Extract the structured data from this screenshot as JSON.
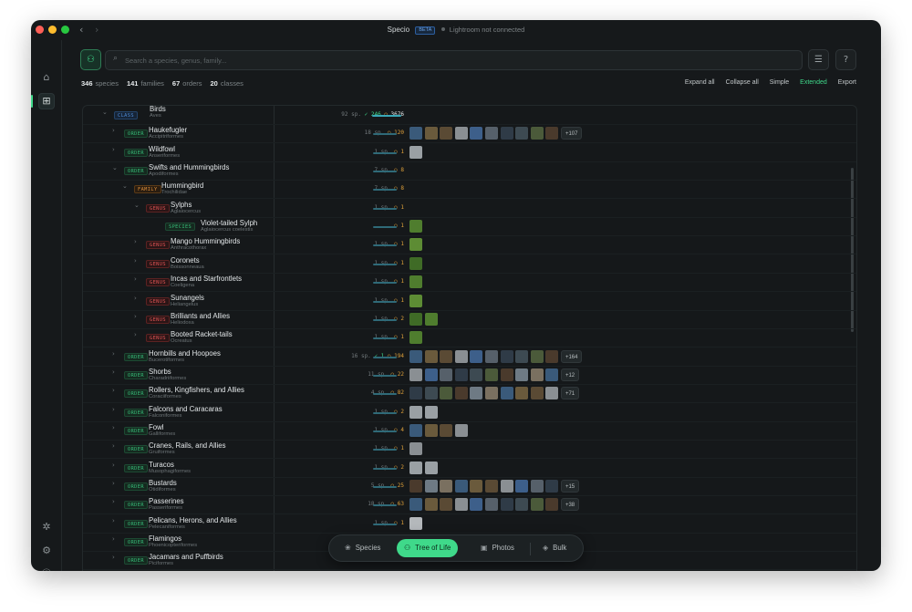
{
  "app": {
    "title": "Specio",
    "badge": "BETA",
    "connection": "Lightroom not connected"
  },
  "rail": {
    "home_icon": "home-icon",
    "grid_icon": "grid-icon",
    "bug_icon": "bug-icon",
    "settings_icon": "gear-icon",
    "help_icon": "help-icon"
  },
  "search": {
    "placeholder": "Search a species, genus, family...",
    "value": ""
  },
  "stats": [
    {
      "count": "346",
      "label": "species"
    },
    {
      "count": "141",
      "label": "families"
    },
    {
      "count": "67",
      "label": "orders"
    },
    {
      "count": "20",
      "label": "classes"
    }
  ],
  "actions": [
    "Expand all",
    "Collapse all",
    "Simple",
    "Extended",
    "Export"
  ],
  "active_action": "Extended",
  "colors": {
    "accent": "#3fd98a",
    "order": "#37bf7a",
    "family": "#d98c3a",
    "genus": "#e05454",
    "class": "#4d8ad6"
  },
  "rows": [
    {
      "rank": "CLASS",
      "name": "Birds",
      "sci": "Aves",
      "depth": 0,
      "chev": "⌄",
      "species": "92 sp.",
      "seen": "246",
      "photos": "3676",
      "bar": 1.0,
      "thumbs": 0,
      "more": ""
    },
    {
      "rank": "ORDER",
      "name": "Haukefugler",
      "sci": "Accipitriformes",
      "depth": 1,
      "chev": "›",
      "species": "18 sp.",
      "seen": "",
      "photos": "120",
      "bar": 0.8,
      "thumbs": 10,
      "more": "+107"
    },
    {
      "rank": "ORDER",
      "name": "Wildfowl",
      "sci": "Anseriformes",
      "depth": 1,
      "chev": "›",
      "species": "1 sp.",
      "seen": "",
      "photos": "1",
      "bar": 0.8,
      "thumbs": 1,
      "more": ""
    },
    {
      "rank": "ORDER",
      "name": "Swifts and Hummingbirds",
      "sci": "Apodiformes",
      "depth": 1,
      "chev": "⌄",
      "species": "7 sp.",
      "seen": "",
      "photos": "8",
      "bar": 0.8,
      "thumbs": 0,
      "more": ""
    },
    {
      "rank": "FAMILY",
      "name": "Hummingbird",
      "sci": "Trochilidae",
      "depth": 2,
      "chev": "⌄",
      "species": "7 sp.",
      "seen": "",
      "photos": "8",
      "bar": 0.8,
      "thumbs": 0,
      "more": ""
    },
    {
      "rank": "GENUS",
      "name": "Sylphs",
      "sci": "Aglaiocercus",
      "depth": 3,
      "chev": "⌄",
      "species": "1 sp.",
      "seen": "",
      "photos": "1",
      "bar": 0.8,
      "thumbs": 0,
      "more": ""
    },
    {
      "rank": "SPECIES",
      "name": "Violet-tailed Sylph",
      "sci": "Aglaiocercus coelestis",
      "depth": 4,
      "chev": "",
      "species": "",
      "seen": "",
      "photos": "1",
      "bar": 0.8,
      "thumbs": 1,
      "more": ""
    },
    {
      "rank": "GENUS",
      "name": "Mango Hummingbirds",
      "sci": "Anthracothorax",
      "depth": 3,
      "chev": "›",
      "species": "1 sp.",
      "seen": "",
      "photos": "1",
      "bar": 0.8,
      "thumbs": 1,
      "more": ""
    },
    {
      "rank": "GENUS",
      "name": "Coronets",
      "sci": "Boissonneaua",
      "depth": 3,
      "chev": "›",
      "species": "1 sp.",
      "seen": "",
      "photos": "1",
      "bar": 0.8,
      "thumbs": 1,
      "more": ""
    },
    {
      "rank": "GENUS",
      "name": "Incas and Starfrontlets",
      "sci": "Coeligena",
      "depth": 3,
      "chev": "›",
      "species": "1 sp.",
      "seen": "",
      "photos": "1",
      "bar": 0.8,
      "thumbs": 1,
      "more": ""
    },
    {
      "rank": "GENUS",
      "name": "Sunangels",
      "sci": "Heliangelus",
      "depth": 3,
      "chev": "›",
      "species": "1 sp.",
      "seen": "",
      "photos": "1",
      "bar": 0.8,
      "thumbs": 1,
      "more": ""
    },
    {
      "rank": "GENUS",
      "name": "Brilliants and Allies",
      "sci": "Heliodoxa",
      "depth": 3,
      "chev": "›",
      "species": "1 sp.",
      "seen": "",
      "photos": "2",
      "bar": 0.8,
      "thumbs": 2,
      "more": ""
    },
    {
      "rank": "GENUS",
      "name": "Booted Racket-tails",
      "sci": "Ocreatus",
      "depth": 3,
      "chev": "›",
      "species": "1 sp.",
      "seen": "",
      "photos": "1",
      "bar": 0.8,
      "thumbs": 1,
      "more": ""
    },
    {
      "rank": "ORDER",
      "name": "Hornbills and Hoopoes",
      "sci": "Bucerotiformes",
      "depth": 1,
      "chev": "›",
      "species": "16 sp.",
      "seen": "1",
      "photos": "194",
      "bar": 0.8,
      "thumbs": 10,
      "more": "+164"
    },
    {
      "rank": "ORDER",
      "name": "Shorbs",
      "sci": "Charadriiformes",
      "depth": 1,
      "chev": "›",
      "species": "11 sp.",
      "seen": "",
      "photos": "22",
      "bar": 0.8,
      "thumbs": 10,
      "more": "+12"
    },
    {
      "rank": "ORDER",
      "name": "Rollers, Kingfishers, and Allies",
      "sci": "Coraciiformes",
      "depth": 1,
      "chev": "›",
      "species": "4 sp.",
      "seen": "",
      "photos": "82",
      "bar": 0.8,
      "thumbs": 10,
      "more": "+71"
    },
    {
      "rank": "ORDER",
      "name": "Falcons and Caracaras",
      "sci": "Falconiformes",
      "depth": 1,
      "chev": "›",
      "species": "1 sp.",
      "seen": "",
      "photos": "2",
      "bar": 0.8,
      "thumbs": 2,
      "more": ""
    },
    {
      "rank": "ORDER",
      "name": "Fowl",
      "sci": "Galliformes",
      "depth": 1,
      "chev": "›",
      "species": "1 sp.",
      "seen": "",
      "photos": "4",
      "bar": 0.8,
      "thumbs": 4,
      "more": ""
    },
    {
      "rank": "ORDER",
      "name": "Cranes, Rails, and Allies",
      "sci": "Gruiformes",
      "depth": 1,
      "chev": "›",
      "species": "1 sp.",
      "seen": "",
      "photos": "1",
      "bar": 0.8,
      "thumbs": 1,
      "more": ""
    },
    {
      "rank": "ORDER",
      "name": "Turacos",
      "sci": "Musophagiformes",
      "depth": 1,
      "chev": "›",
      "species": "1 sp.",
      "seen": "",
      "photos": "2",
      "bar": 0.8,
      "thumbs": 2,
      "more": ""
    },
    {
      "rank": "ORDER",
      "name": "Bustards",
      "sci": "Otidiformes",
      "depth": 1,
      "chev": "›",
      "species": "5 sp.",
      "seen": "",
      "photos": "25",
      "bar": 0.8,
      "thumbs": 10,
      "more": "+15"
    },
    {
      "rank": "ORDER",
      "name": "Passerines",
      "sci": "Passeriformes",
      "depth": 1,
      "chev": "›",
      "species": "18 sp.",
      "seen": "",
      "photos": "63",
      "bar": 0.8,
      "thumbs": 10,
      "more": "+38"
    },
    {
      "rank": "ORDER",
      "name": "Pelicans, Herons, and Allies",
      "sci": "Pelecaniformes",
      "depth": 1,
      "chev": "›",
      "species": "1 sp.",
      "seen": "",
      "photos": "1",
      "bar": 0.8,
      "thumbs": 1,
      "more": ""
    },
    {
      "rank": "ORDER",
      "name": "Flamingos",
      "sci": "Phoenicopteriformes",
      "depth": 1,
      "chev": "›",
      "species": "",
      "seen": "",
      "photos": "",
      "bar": 0,
      "thumbs": 0,
      "more": ""
    },
    {
      "rank": "ORDER",
      "name": "Jacamars and Puffbirds",
      "sci": "Piciformes",
      "depth": 1,
      "chev": "›",
      "species": "",
      "seen": "",
      "photos": "",
      "bar": 0,
      "thumbs": 0,
      "more": ""
    }
  ],
  "bottom_nav": [
    {
      "label": "Species",
      "icon": "species-icon",
      "glyph": "❀"
    },
    {
      "label": "Tree of Life",
      "icon": "tree-icon",
      "glyph": "⚇"
    },
    {
      "label": "Photos",
      "icon": "photos-icon",
      "glyph": "▣"
    },
    {
      "label": "Bulk",
      "icon": "bulk-icon",
      "glyph": "◈"
    }
  ],
  "active_nav": "Tree of Life"
}
